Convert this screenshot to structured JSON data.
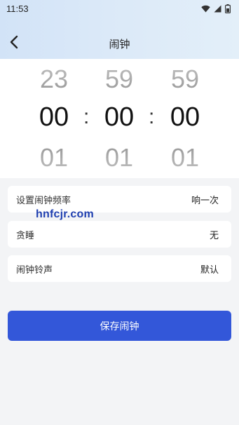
{
  "status_bar": {
    "time": "11:53",
    "icons": [
      "wifi-icon",
      "signal-icon",
      "battery-icon"
    ]
  },
  "nav": {
    "title": "闹钟",
    "back_icon": "chevron-left-icon"
  },
  "picker": {
    "hours": {
      "prev": "23",
      "current": "00",
      "next": "01"
    },
    "minutes": {
      "prev": "59",
      "current": "00",
      "next": "01"
    },
    "seconds": {
      "prev": "59",
      "current": "00",
      "next": "01"
    },
    "separator": ":"
  },
  "settings": [
    {
      "label": "设置闹钟频率",
      "value": "响一次"
    },
    {
      "label": "贪睡",
      "value": "无"
    },
    {
      "label": "闹钟铃声",
      "value": "默认"
    }
  ],
  "watermark": "hnfcjr.com",
  "save_button": {
    "label": "保存闹钟"
  },
  "colors": {
    "accent": "#3357d9",
    "background": "#f3f4f6",
    "header_gradient_start": "#d2e3f7",
    "header_gradient_end": "#e3eff9"
  }
}
